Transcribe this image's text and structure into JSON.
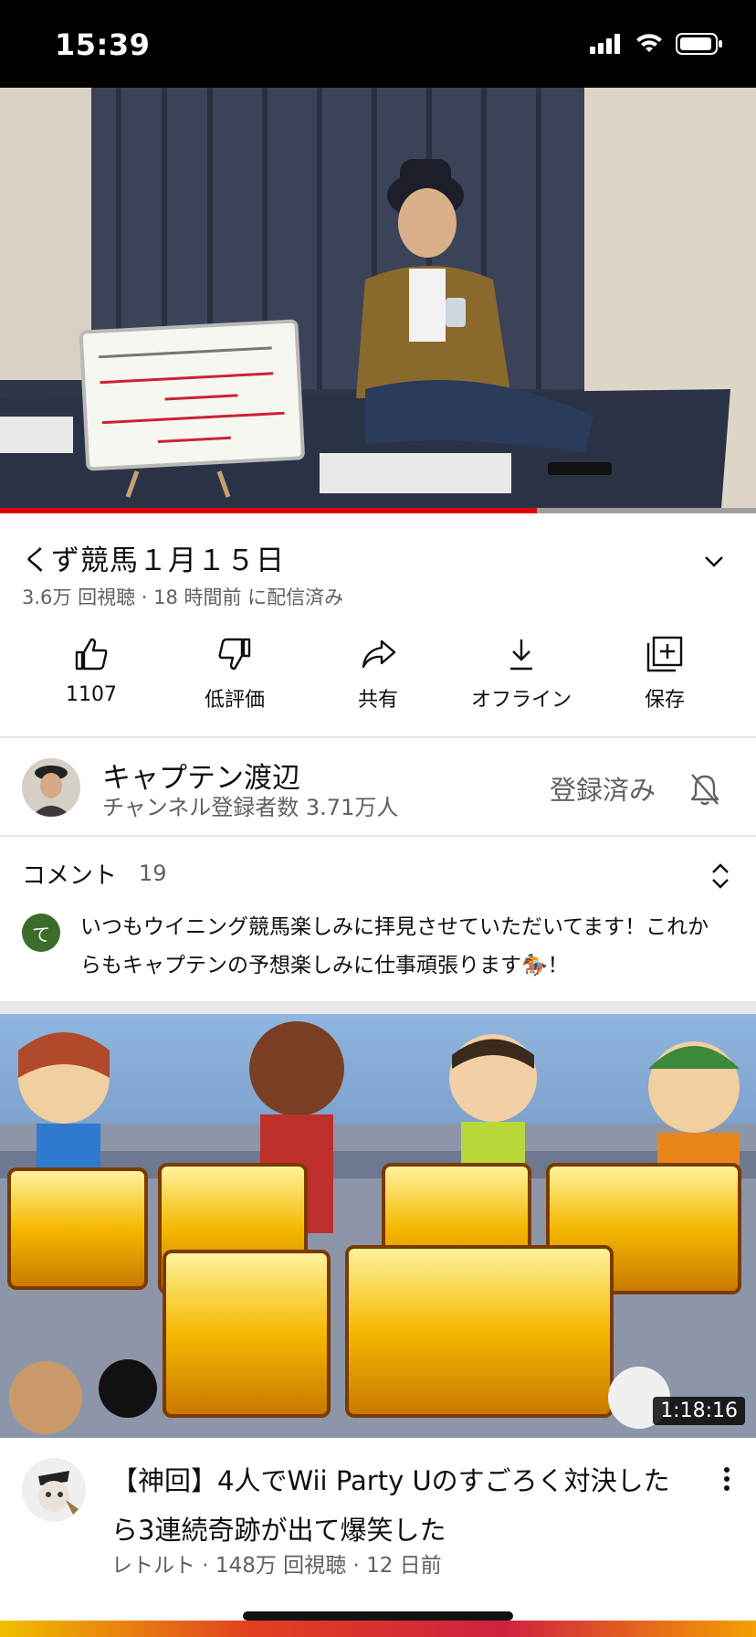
{
  "status_bar": {
    "time": "15:39"
  },
  "video": {
    "title": "くず競馬１月１５日",
    "meta": "3.6万 回視聴 · 18 時間前 に配信済み",
    "progress_fraction": 0.71
  },
  "actions": [
    {
      "label": "1107",
      "icon": "thumbs-up-icon"
    },
    {
      "label": "低評価",
      "icon": "thumbs-down-icon"
    },
    {
      "label": "共有",
      "icon": "share-icon"
    },
    {
      "label": "オフライン",
      "icon": "download-icon"
    },
    {
      "label": "保存",
      "icon": "add-to-playlist-icon"
    }
  ],
  "channel": {
    "name": "キャプテン渡辺",
    "subscribers": "チャンネル登録者数 3.71万人",
    "subscribed_label": "登録済み"
  },
  "comments": {
    "title": "コメント",
    "count": "19",
    "first": {
      "avatar_letter": "て",
      "text": "いつもウイニング競馬楽しみに拝見させていただいてます！これからもキャプテンの予想楽しみに仕事頑張ります🏇！"
    }
  },
  "recommended": {
    "duration": "1:18:16",
    "title": "【神回】4人でWii Party Uのすごろく対決したら3連続奇跡が出て爆笑した",
    "meta": "レトルト · 148万 回視聴 · 12 日前"
  },
  "colors": {
    "accent_red": "#e00000",
    "secondary_text": "#606060",
    "comment_avatar": "#3d6b2b"
  }
}
